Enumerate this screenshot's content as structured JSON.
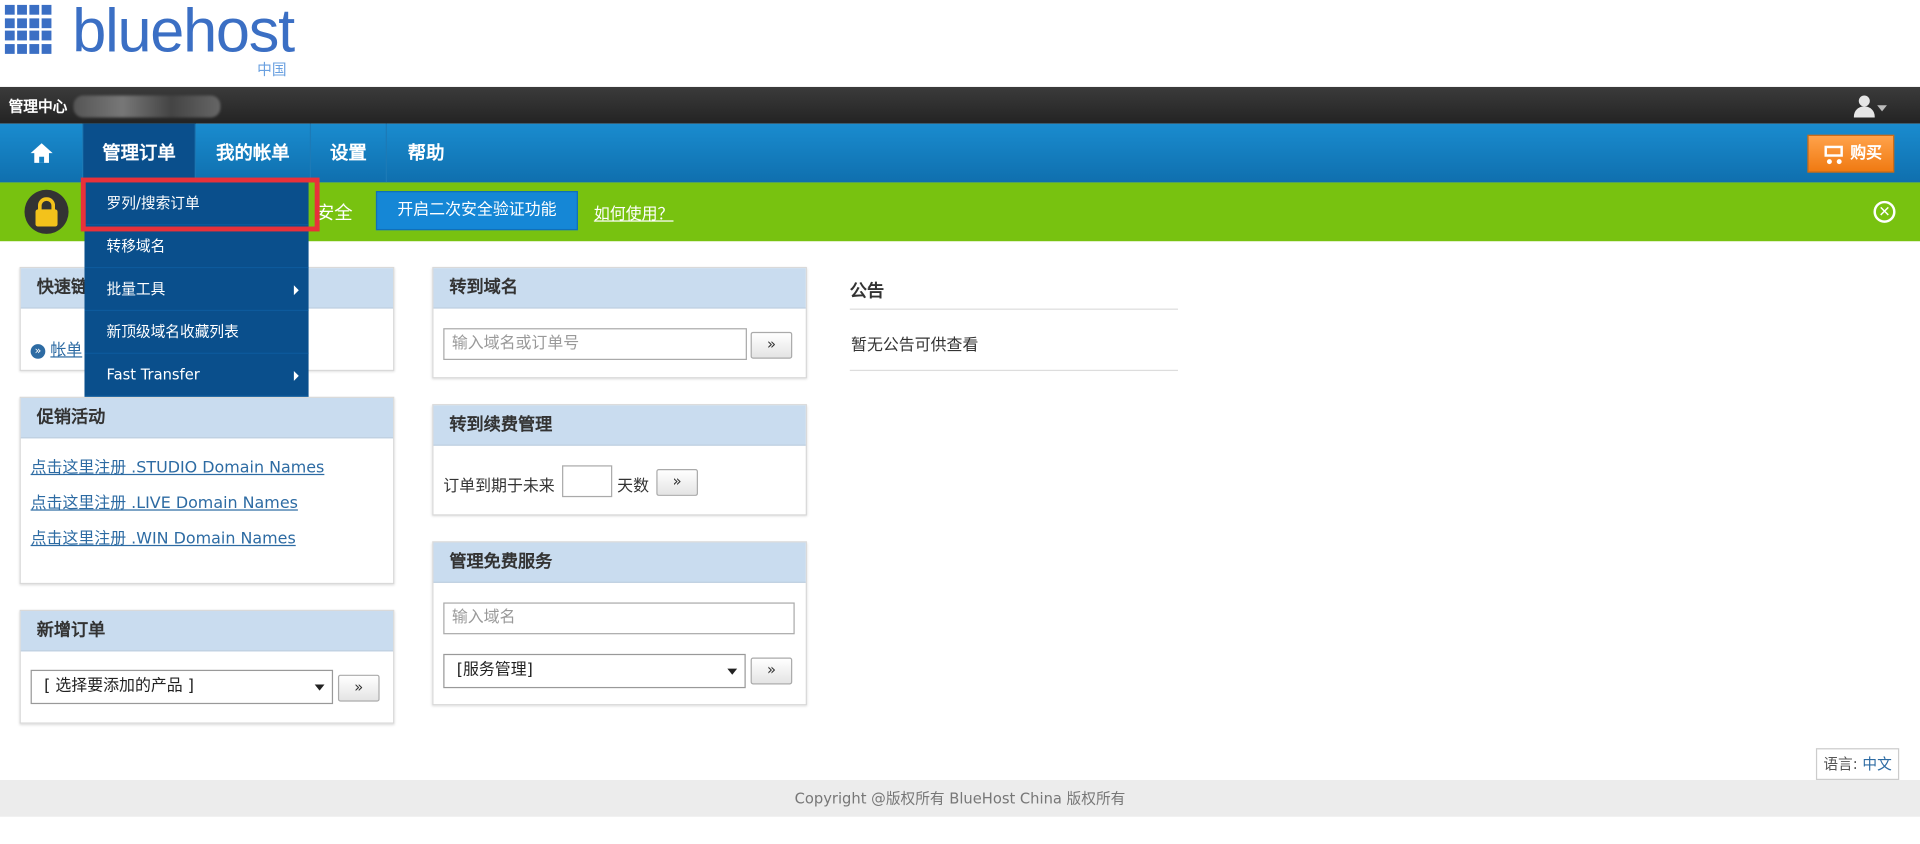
{
  "brand": {
    "logo_text": "bluehost",
    "logo_sub": "中国",
    "accent": "#3b6fc4"
  },
  "topbar": {
    "admin_label": "管理中心"
  },
  "nav": {
    "home_icon": "home-icon",
    "items": [
      {
        "label": "管理订单"
      },
      {
        "label": "我的帐单"
      },
      {
        "label": "设置"
      },
      {
        "label": "帮助"
      }
    ],
    "buy_label": "购买",
    "buy_icon": "cart-icon"
  },
  "banner": {
    "text_tail": "安全",
    "button_label": "开启二次安全验证功能",
    "help_link": "如何使用？",
    "close_icon": "close-icon"
  },
  "dropdown": {
    "items": [
      {
        "label": "罗列/搜索订单",
        "has_submenu": false
      },
      {
        "label": "转移域名",
        "has_submenu": false
      },
      {
        "label": "批量工具",
        "has_submenu": true
      },
      {
        "label": "新顶级域名收藏列表",
        "has_submenu": false
      },
      {
        "label": "Fast Transfer",
        "has_submenu": true
      }
    ]
  },
  "quick_links": {
    "title_visible": "快速链",
    "link_visible": "帐单"
  },
  "promotions": {
    "title": "促销活动",
    "links": [
      "点击这里注册 .STUDIO Domain Names",
      "点击这里注册 .LIVE Domain Names",
      "点击这里注册 .WIN Domain Names"
    ]
  },
  "new_order": {
    "title": "新增订单",
    "select_value": "[ 选择要添加的产品 ]",
    "go": "»"
  },
  "goto_domain": {
    "title": "转到域名",
    "placeholder": "输入域名或订单号",
    "go": "»"
  },
  "renewal": {
    "title": "转到续费管理",
    "prefix": "订单到期于未来",
    "input_value": "",
    "suffix": "天数",
    "go": "»"
  },
  "free_services": {
    "title": "管理免费服务",
    "placeholder": "输入域名",
    "select_value": "[服务管理]",
    "go": "»"
  },
  "announcement": {
    "title": "公告",
    "text": "暂无公告可供查看"
  },
  "language": {
    "label": "语言:",
    "value": "中文"
  },
  "footer": {
    "copyright": "Copyright @版权所有 BlueHost China 版权所有"
  }
}
